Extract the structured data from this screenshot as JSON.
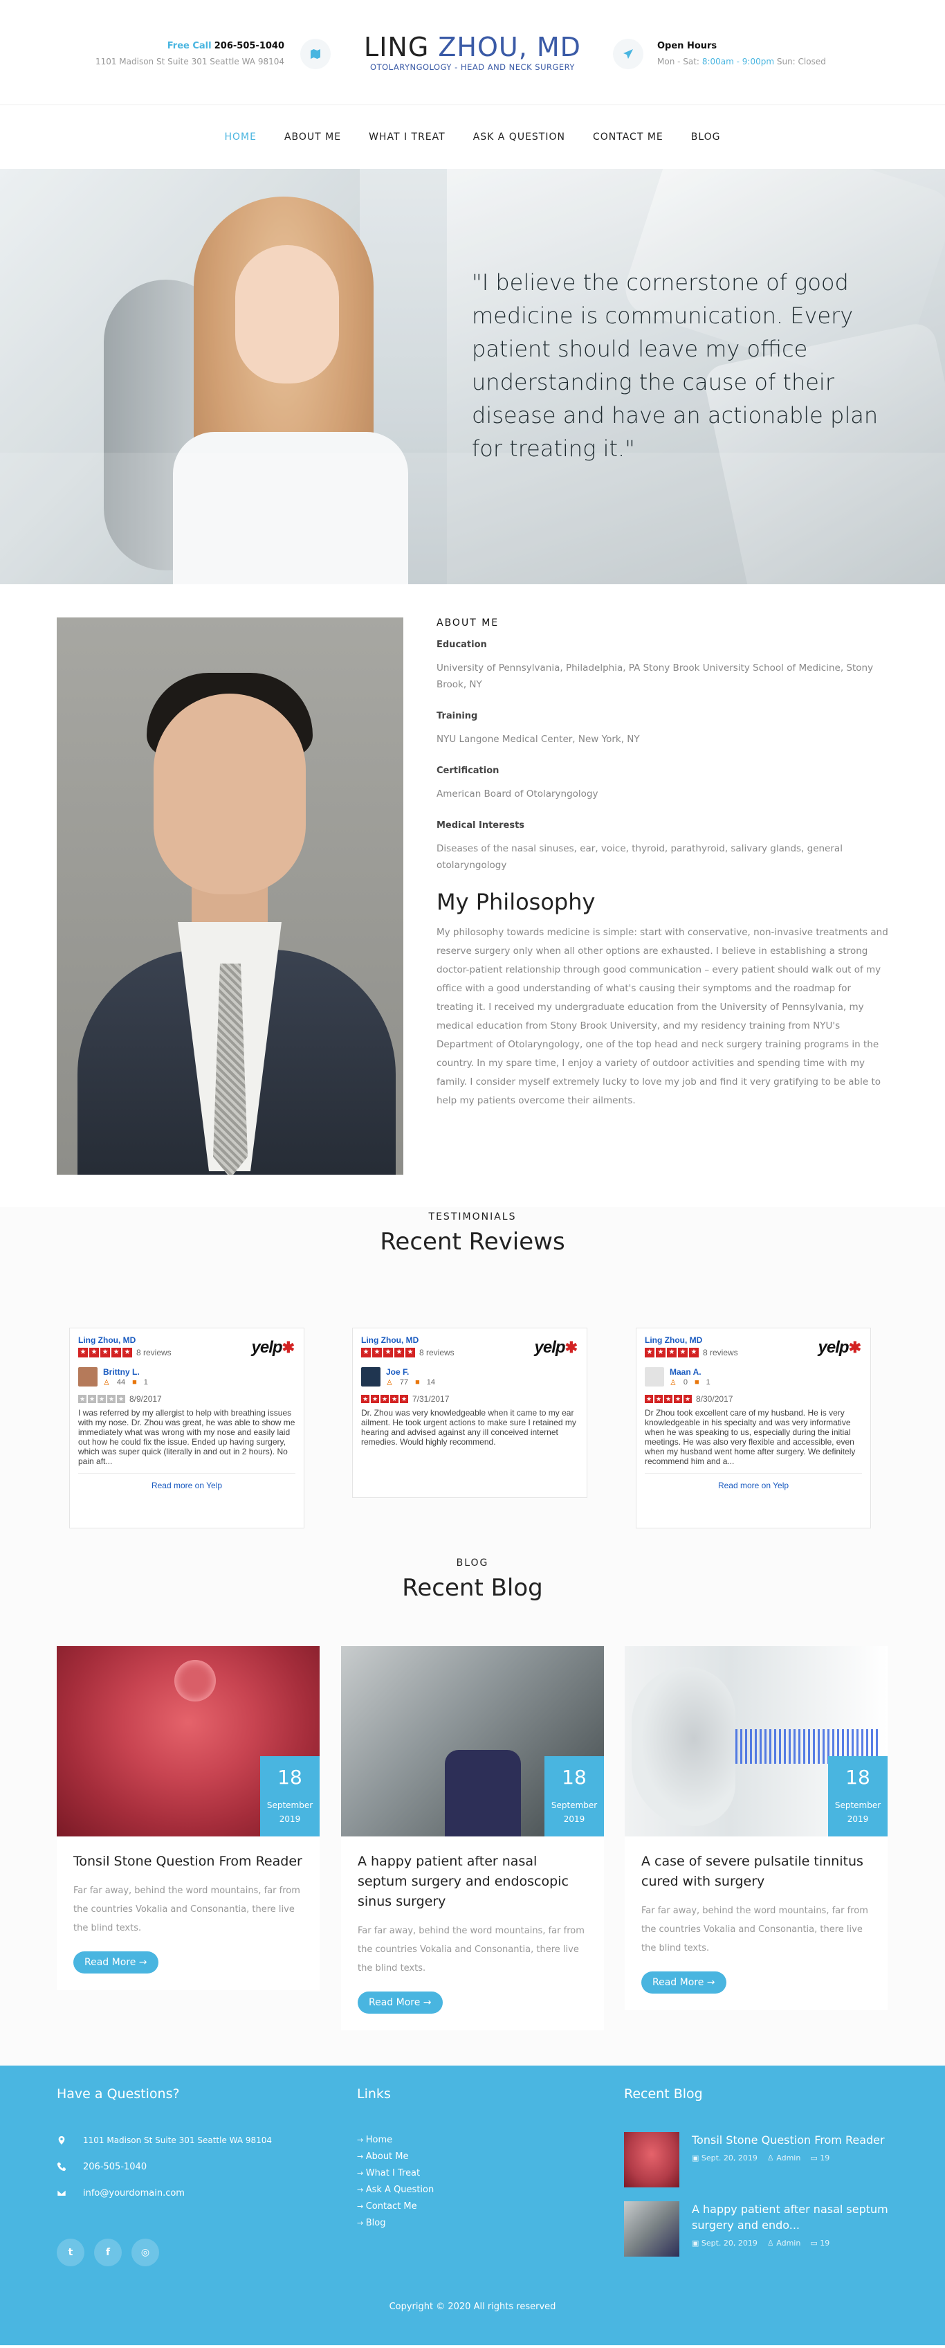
{
  "header": {
    "call_label": "Free Call",
    "call_number": "206-505-1040",
    "address": "1101 Madison St Suite 301 Seattle WA 98104",
    "logo_first": "LING",
    "logo_last": "ZHOU, MD",
    "logo_tagline": "OTOLARYNGOLOGY - HEAD AND NECK SURGERY",
    "hours_title": "Open Hours",
    "hours_days": "Mon - Sat:",
    "hours_time": "8:00am - 9:00pm",
    "hours_closed": "Sun: Closed"
  },
  "nav": {
    "items": [
      "HOME",
      "ABOUT ME",
      "WHAT I TREAT",
      "ASK A QUESTION",
      "CONTACT ME",
      "BLOG"
    ]
  },
  "hero": {
    "quote": "\"I believe the cornerstone of good medicine is communication. Every patient should leave my office understanding the cause of their disease and have an actionable plan for treating it.\""
  },
  "about": {
    "kicker": "ABOUT ME",
    "education_label": "Education",
    "education": "University of Pennsylvania, Philadelphia, PA Stony Brook University School of Medicine, Stony Brook, NY",
    "training_label": "Training",
    "training": "NYU Langone Medical Center, New York, NY",
    "certification_label": "Certification",
    "certification": "American Board of Otolaryngology",
    "interests_label": "Medical Interests",
    "interests": "Diseases of the nasal sinuses, ear, voice, thyroid, parathyroid, salivary glands, general otolaryngology",
    "philosophy_title": "My Philosophy",
    "philosophy": "My philosophy towards medicine is simple: start with conservative, non-invasive treatments and reserve surgery only when all other options are exhausted. I believe in establishing a strong doctor-patient relationship through good communication – every patient should walk out of my office with a good understanding of what's causing their symptoms and the roadmap for treating it. I received my undergraduate education from the University of Pennsylvania, my medical education from Stony Brook University, and my residency training from NYU's Department of Otolaryngology, one of the top head and neck surgery training programs in the country. In my spare time, I enjoy a variety of outdoor activities and spending time with my family. I consider myself extremely lucky to love my job and find it very gratifying to be able to help my patients overcome their ailments."
  },
  "testimonials": {
    "kicker": "TESTIMONIALS",
    "title": "Recent Reviews",
    "reviews": [
      {
        "biz": "Ling Zhou, MD",
        "count": "8 reviews",
        "user": "Brittny L.",
        "friends": "44",
        "reviews_n": "1",
        "date": "8/9/2017",
        "rating_gray": true,
        "body": "I was referred by my allergist to help with breathing issues with my nose. Dr. Zhou was great, he was able to show me immediately what was wrong with my nose and easily laid out how he could fix the issue. Ended up having surgery, which was super quick (literally in and out in 2 hours). No pain aft...",
        "more": "Read more on Yelp"
      },
      {
        "biz": "Ling Zhou, MD",
        "count": "8 reviews",
        "user": "Joe F.",
        "friends": "77",
        "reviews_n": "14",
        "date": "7/31/2017",
        "rating_gray": false,
        "body": "Dr. Zhou was very knowledgeable when it came to my ear ailment. He took urgent actions to make sure I retained my hearing and advised against any ill conceived internet remedies. Would highly recommend.",
        "more": ""
      },
      {
        "biz": "Ling Zhou, MD",
        "count": "8 reviews",
        "user": "Maan A.",
        "friends": "0",
        "reviews_n": "1",
        "date": "8/30/2017",
        "rating_gray": false,
        "body": "Dr Zhou took excellent care of my husband. He is very knowledgeable in his specialty and was very informative when he was speaking to us, especially during the initial meetings. He was also very flexible and accessible, even when my husband went home after surgery. We definitely recommend him and a...",
        "more": "Read more on Yelp"
      }
    ],
    "yelp_logo": "yelp"
  },
  "blog": {
    "kicker": "BLOG",
    "title": "Recent Blog",
    "posts": [
      {
        "day": "18",
        "month": "September",
        "year": "2019",
        "title": "Tonsil Stone Question From Reader",
        "excerpt": "Far far away, behind the word mountains, far from the countries Vokalia and Consonantia, there live the blind texts.",
        "button": "Read More →"
      },
      {
        "day": "18",
        "month": "September",
        "year": "2019",
        "title": "A happy patient after nasal septum surgery and endoscopic sinus surgery",
        "excerpt": "Far far away, behind the word mountains, far from the countries Vokalia and Consonantia, there live the blind texts.",
        "button": "Read More →"
      },
      {
        "day": "18",
        "month": "September",
        "year": "2019",
        "title": "A case of severe pulsatile tinnitus cured with surgery",
        "excerpt": "Far far away, behind the word mountains, far from the countries Vokalia and Consonantia, there live the blind texts.",
        "button": "Read More →"
      }
    ]
  },
  "footer": {
    "questions_title": "Have a Questions?",
    "address": "1101 Madison St Suite 301 Seattle WA 98104",
    "phone": "206-505-1040",
    "email": "info@yourdomain.com",
    "links_title": "Links",
    "links": [
      "Home",
      "About Me",
      "What I Treat",
      "Ask A Question",
      "Contact Me",
      "Blog"
    ],
    "recent_title": "Recent Blog",
    "recent": [
      {
        "title": "Tonsil Stone Question From Reader",
        "date": "Sept. 20, 2019",
        "author": "Admin",
        "comments": "19"
      },
      {
        "title": "A happy patient after nasal septum surgery and endo...",
        "date": "Sept. 20, 2019",
        "author": "Admin",
        "comments": "19"
      }
    ],
    "copyright": "Copyright © 2020 All rights reserved"
  },
  "colors": {
    "accent": "#49b5e0",
    "logo_blue": "#3a5aa6",
    "yelp_red": "#d32323"
  }
}
